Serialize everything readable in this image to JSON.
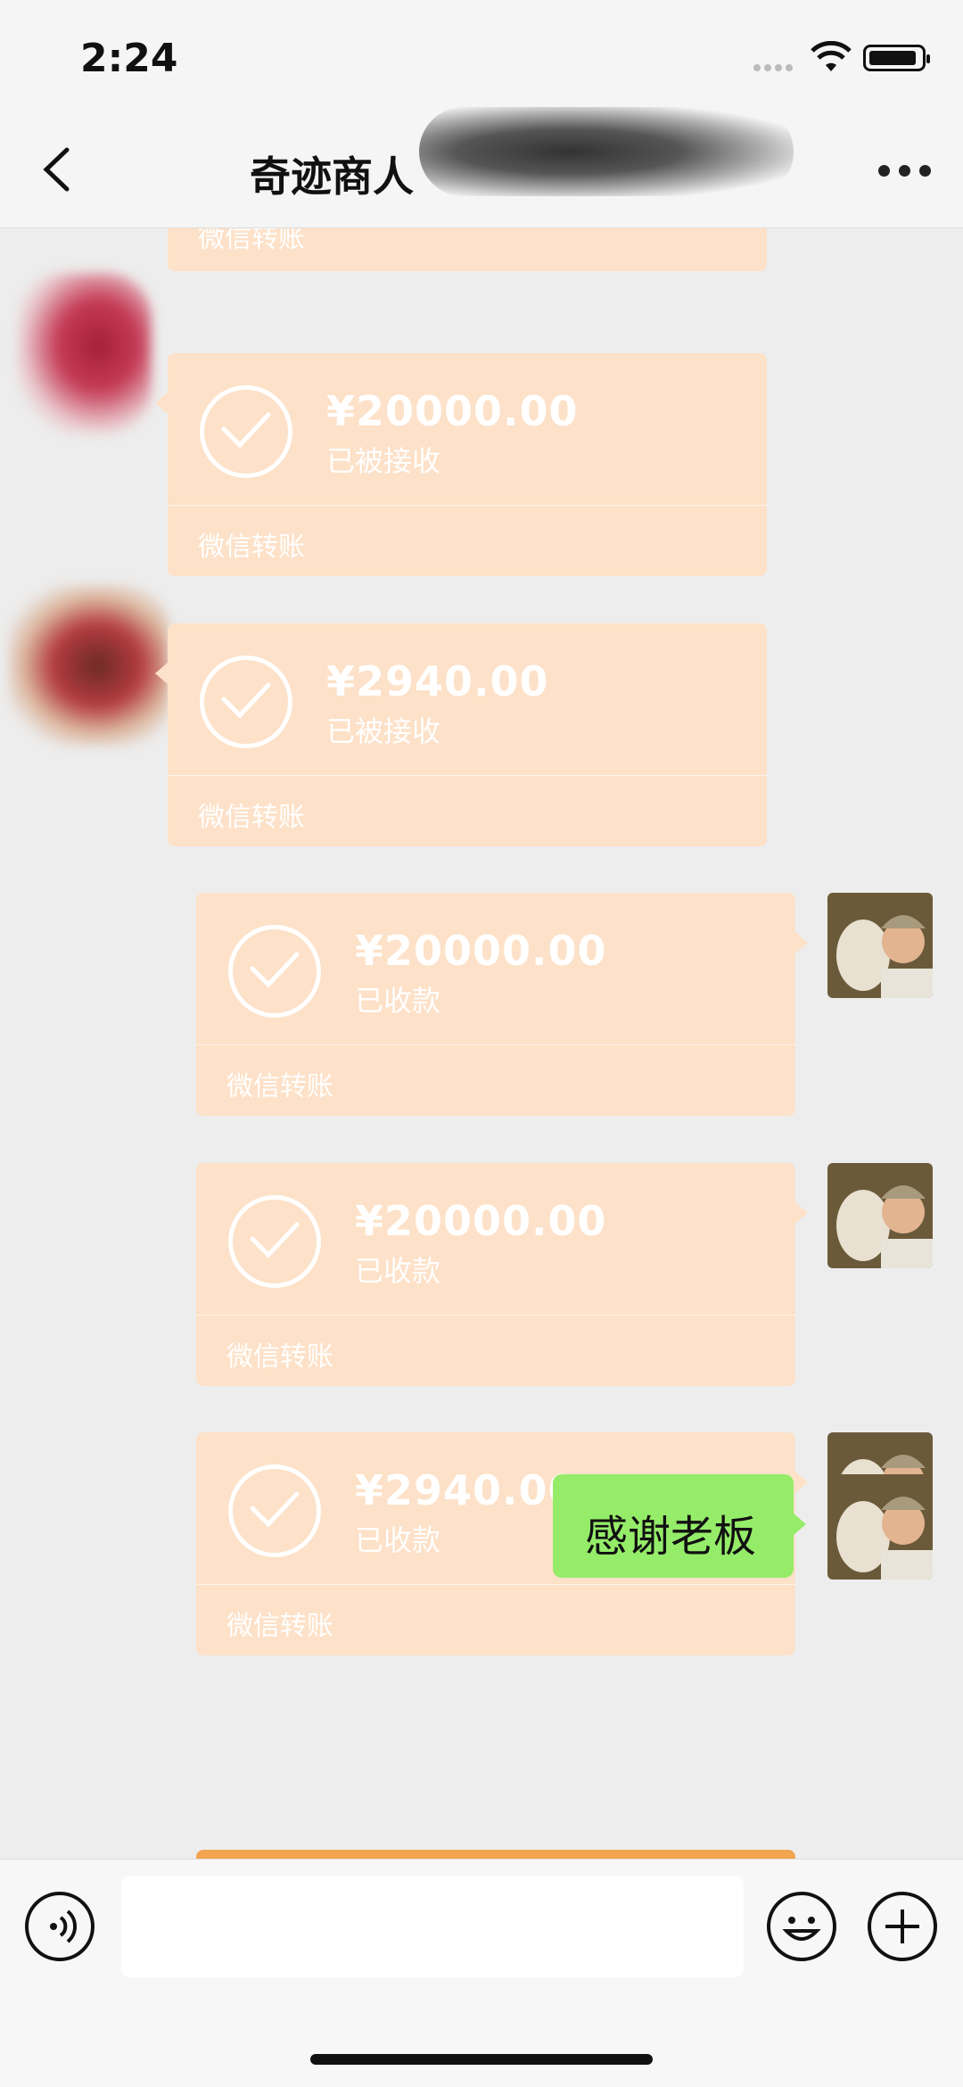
{
  "status_bar": {
    "time": "2:24"
  },
  "nav": {
    "title": "奇迹商人"
  },
  "transfers": [
    {
      "side": "left",
      "amount": "",
      "status": "",
      "brand": "微信转账"
    },
    {
      "side": "left",
      "amount": "¥20000.00",
      "status": "已被接收",
      "brand": "微信转账"
    },
    {
      "side": "left",
      "amount": "¥2940.00",
      "status": "已被接收",
      "brand": "微信转账"
    },
    {
      "side": "right",
      "amount": "¥20000.00",
      "status": "已收款",
      "brand": "微信转账"
    },
    {
      "side": "right",
      "amount": "¥20000.00",
      "status": "已收款",
      "brand": "微信转账"
    },
    {
      "side": "right",
      "amount": "¥2940.00",
      "status": "已收款",
      "brand": "微信转账"
    }
  ],
  "message": {
    "text": "感谢老板"
  },
  "icons": {
    "back": "chevron-left-icon",
    "more": "ellipsis-icon",
    "voice": "voice-icon",
    "emoji": "emoji-icon",
    "plus": "plus-icon",
    "transfer": "check-circle-icon"
  },
  "colors": {
    "transfer_card": "#fde1c8",
    "own_message": "#95ec69",
    "background": "#ededed"
  }
}
